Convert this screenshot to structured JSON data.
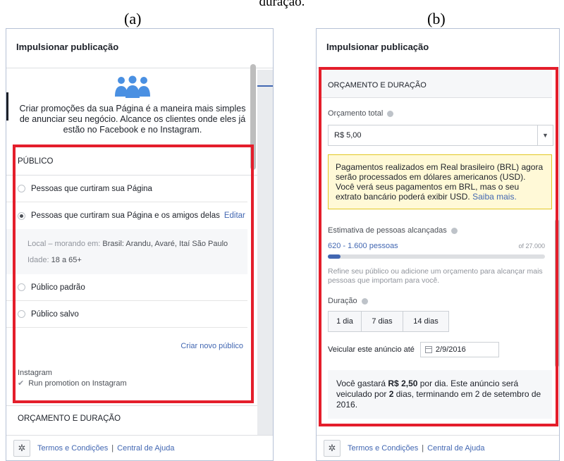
{
  "caption": "duração.",
  "panel_a": {
    "label": "(a)",
    "header_title": "Impulsionar publicação",
    "promo_text": "Criar promoções da sua Página é a maneira mais simples de anunciar seu negócio. Alcance os clientes onde eles já estão no Facebook e no Instagram.",
    "public_section": {
      "title": "PÚBLICO",
      "options": [
        {
          "label": "Pessoas que curtiram sua Página",
          "checked": false
        },
        {
          "label": "Pessoas que curtiram sua Página e os amigos delas",
          "checked": true,
          "edit": "Editar"
        }
      ],
      "location_label": "Local – morando em:",
      "location_value": "Brasil: Arandu, Avaré, Itaí São Paulo",
      "age_label": "Idade:",
      "age_value": "18 a 65+",
      "more_options": [
        {
          "label": "Público padrão"
        },
        {
          "label": "Público salvo"
        }
      ],
      "create_link": "Criar novo público",
      "instagram_title": "Instagram",
      "instagram_option": "Run promotion on Instagram"
    },
    "budget_section_title": "ORÇAMENTO E DURAÇÃO",
    "footer": {
      "terms": "Termos e Condições",
      "separator": "|",
      "help": "Central de Ajuda"
    }
  },
  "panel_b": {
    "label": "(b)",
    "header_title": "Impulsionar publicação",
    "section_title": "ORÇAMENTO E DURAÇÃO",
    "budget_label": "Orçamento total",
    "budget_value": "R$ 5,00",
    "notice_text": "Pagamentos realizados em Real brasileiro (BRL) agora serão processados em dólares americanos (USD). Você verá seus pagamentos em BRL, mas o seu extrato bancário poderá exibir USD.",
    "notice_link": "Saiba mais.",
    "reach_label": "Estimativa de pessoas alcançadas",
    "reach_value": "620 - 1.600 pessoas",
    "reach_max": "of 27.000",
    "reach_fraction": 0.06,
    "reach_hint": "Refine seu público ou adicione um orçamento para alcançar mais pessoas que importam para você.",
    "duration_label": "Duração",
    "durations": [
      "1 dia",
      "7 dias",
      "14 dias"
    ],
    "run_until_label": "Veicular este anúncio até",
    "run_until_date": "2/9/2016",
    "summary": {
      "t1": "Você gastará ",
      "amount": "R$ 2,50",
      "t2": " por dia. Este anúncio será veiculado por ",
      "days": "2",
      "t3": " dias, terminando em 2 de setembro de 2016."
    },
    "footer": {
      "terms": "Termos e Condições",
      "separator": "|",
      "help": "Central de Ajuda"
    }
  },
  "colors": {
    "highlight": "#e41e2b",
    "link": "#4267b2",
    "icon": "#4a90e2",
    "notice_bg": "#fff9d7"
  }
}
